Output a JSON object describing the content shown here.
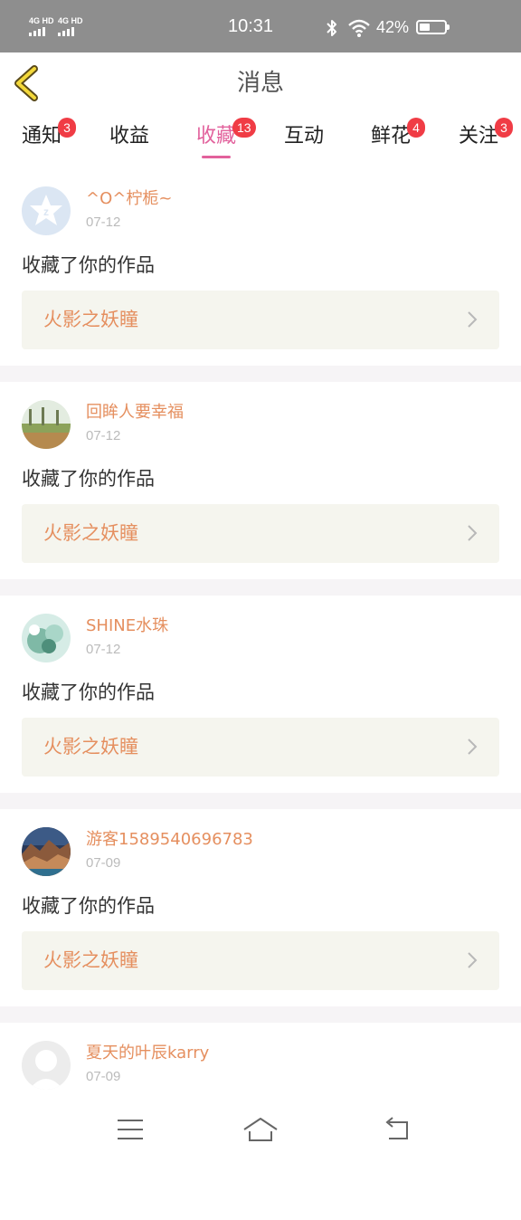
{
  "status_bar": {
    "signal_1": "4G HD",
    "signal_2": "4G HD",
    "time": "10:31",
    "battery_percent": "42%",
    "battery_level": 0.42
  },
  "header": {
    "title": "消息",
    "back_icon": "chevron-left-icon"
  },
  "tabs": [
    {
      "label": "通知",
      "badge": "3",
      "active": false
    },
    {
      "label": "收益",
      "badge": "",
      "active": false
    },
    {
      "label": "收藏",
      "badge": "13",
      "active": true
    },
    {
      "label": "互动",
      "badge": "",
      "active": false
    },
    {
      "label": "鲜花",
      "badge": "4",
      "active": false
    },
    {
      "label": "关注",
      "badge": "3",
      "active": false
    }
  ],
  "feed": [
    {
      "user": "^O^柠栀~",
      "date": "07-12",
      "action": "收藏了你的作品",
      "work": "火影之妖瞳"
    },
    {
      "user": "回眸人要幸福",
      "date": "07-12",
      "action": "收藏了你的作品",
      "work": "火影之妖瞳"
    },
    {
      "user": "SHINE水珠",
      "date": "07-12",
      "action": "收藏了你的作品",
      "work": "火影之妖瞳"
    },
    {
      "user": "游客1589540696783",
      "date": "07-09",
      "action": "收藏了你的作品",
      "work": "火影之妖瞳"
    },
    {
      "user": "夏天的叶辰karry",
      "date": "07-09",
      "action": "",
      "work": ""
    }
  ],
  "colors": {
    "accent_pink": "#e2619c",
    "badge_red": "#f03c45",
    "username_orange": "#e58f5f",
    "back_icon_yellow": "#f3d83a"
  },
  "bottom_nav": {
    "menu_icon": "menu-icon",
    "home_icon": "home-icon",
    "back_icon": "back-icon"
  }
}
